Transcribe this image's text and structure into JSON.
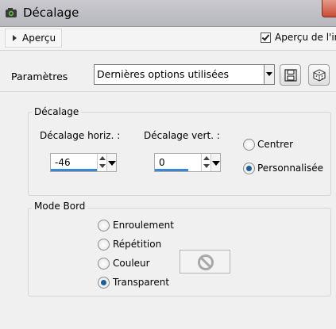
{
  "window": {
    "title": "Décalage",
    "icon": "camera-app-icon"
  },
  "toolbar": {
    "apercu_label": "Aperçu",
    "preview_label": "Aperçu de l'im",
    "preview_checked": true
  },
  "params": {
    "label": "Paramètres",
    "preset_value": "Dernières options utilisées",
    "save_icon": "floppy-disk-icon",
    "random_icon": "dice-icon"
  },
  "decalage": {
    "title": "Décalage",
    "horiz_label": "Décalage horiz. :",
    "horiz_value": "-46",
    "vert_label": "Décalage vert.  :",
    "vert_value": "0",
    "options": [
      {
        "label": "Centrer",
        "selected": false
      },
      {
        "label": "Personnalisée",
        "selected": true
      }
    ]
  },
  "mode_bord": {
    "title": "Mode Bord",
    "options": [
      {
        "label": "Enroulement",
        "selected": false
      },
      {
        "label": "Répétition",
        "selected": false
      },
      {
        "label": "Couleur",
        "selected": false
      },
      {
        "label": "Transparent",
        "selected": true
      }
    ],
    "color_swatch_icon": "no-symbol-icon"
  }
}
